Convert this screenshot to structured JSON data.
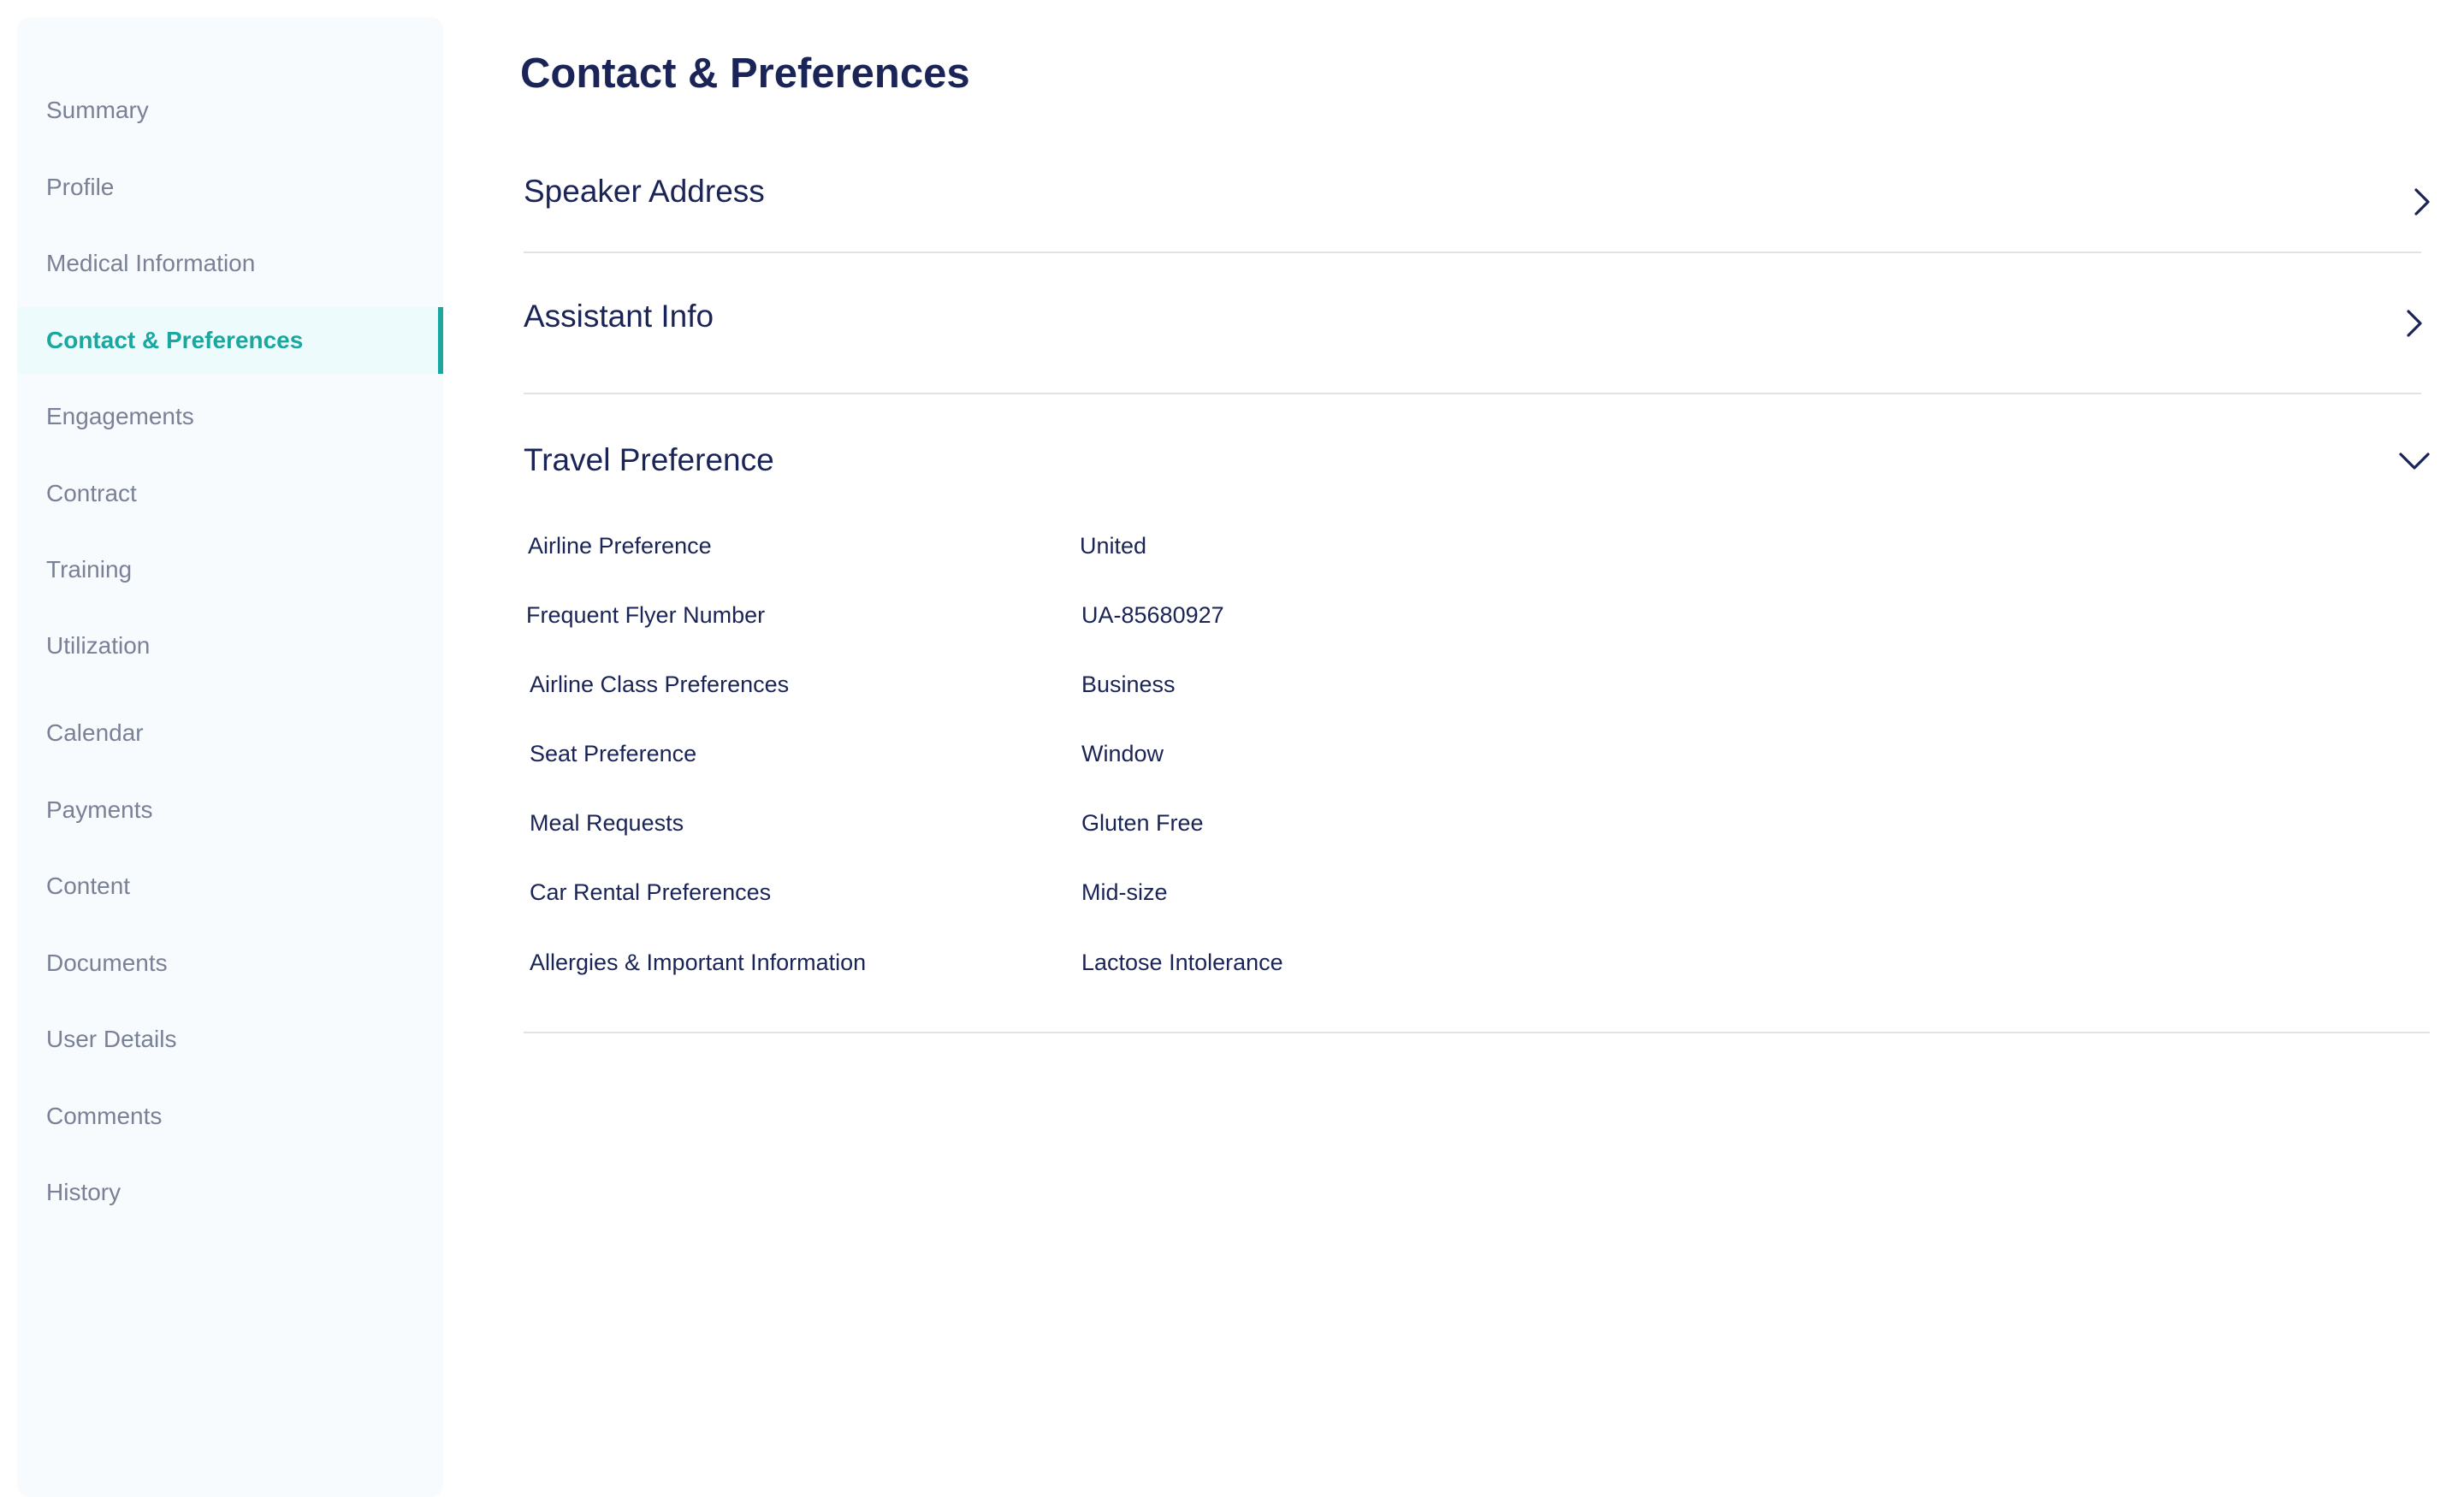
{
  "sidebar": {
    "items": [
      {
        "label": "Summary"
      },
      {
        "label": "Profile"
      },
      {
        "label": "Medical Information"
      },
      {
        "label": "Contact & Preferences"
      },
      {
        "label": "Engagements"
      },
      {
        "label": "Contract"
      },
      {
        "label": "Training"
      },
      {
        "label": "Utilization"
      },
      {
        "label": "Calendar"
      },
      {
        "label": "Payments"
      },
      {
        "label": "Content"
      },
      {
        "label": "Documents"
      },
      {
        "label": "User Details"
      },
      {
        "label": "Comments"
      },
      {
        "label": "History"
      }
    ],
    "active_label": "Contact & Preferences"
  },
  "main": {
    "title": "Contact & Preferences",
    "sections": [
      {
        "title": "Speaker Address",
        "state": "collapsed",
        "icon": "chevron-right-icon"
      },
      {
        "title": "Assistant Info",
        "state": "collapsed",
        "icon": "chevron-right-icon"
      },
      {
        "title": "Travel Preference",
        "state": "expanded",
        "icon": "chevron-down-icon"
      }
    ],
    "travel_preferences": [
      {
        "label": "Airline Preference",
        "value": "United"
      },
      {
        "label": "Frequent Flyer Number",
        "value": "UA-85680927"
      },
      {
        "label": "Airline Class Preferences",
        "value": "Business"
      },
      {
        "label": "Seat Preference",
        "value": "Window"
      },
      {
        "label": "Meal Requests",
        "value": "Gluten Free"
      },
      {
        "label": "Car Rental Preferences",
        "value": "Mid-size"
      },
      {
        "label": "Allergies & Important Information",
        "value": "Lactose Intolerance"
      }
    ]
  },
  "colors": {
    "accent": "#1aa79f",
    "text_primary": "#1a2456",
    "text_muted": "#7a8197",
    "sidebar_bg": "#f7fbfd",
    "divider": "#dfe2e7"
  }
}
